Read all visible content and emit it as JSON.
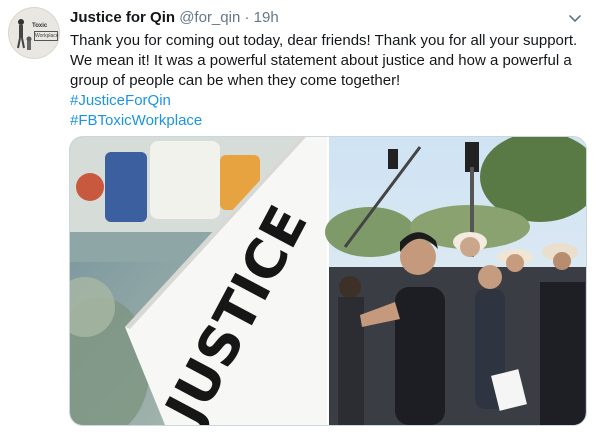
{
  "tweet": {
    "display_name": "Justice for Qin",
    "handle": "@for_qin",
    "separator": "·",
    "time": "19h",
    "text": "Thank you for coming out today, dear friends! Thank you for all your support. We mean it! It was a powerful statement about justice and how a powerful a group of people can be when they come together!",
    "hashtags": [
      "#JusticeForQin",
      "#FBToxicWorkplace"
    ]
  },
  "avatar": {
    "line1": "Toxic",
    "line2": "Workplace"
  },
  "media": {
    "sign_text": "JUSTICE"
  },
  "icons": {
    "more_menu": "chevron-down-icon"
  },
  "colors": {
    "link": "#1b95e0",
    "text": "#14171a",
    "muted": "#657786"
  }
}
